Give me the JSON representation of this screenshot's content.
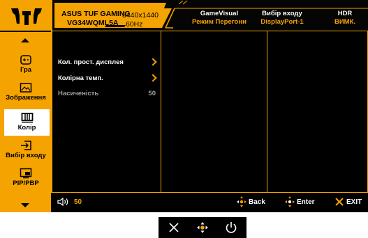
{
  "header": {
    "model_line1": "ASUS TUF GAMING",
    "model_line2": "VG34WQML5A",
    "resolution": "3440x1440",
    "refresh": "60Hz",
    "game_visual": {
      "title": "GameVisual",
      "value": "Режим Перегони"
    },
    "input": {
      "title": "Вибір входу",
      "value": "DisplayPort-1"
    },
    "hdr": {
      "title": "HDR",
      "value": "ВИМК."
    }
  },
  "sidebar": {
    "items": [
      {
        "label": "Гра",
        "icon": "gamepad-icon",
        "active": false
      },
      {
        "label": "Зображення",
        "icon": "image-icon",
        "active": false
      },
      {
        "label": "Колір",
        "icon": "color-icon",
        "active": true
      },
      {
        "label": "Вибір входу",
        "icon": "input-select-icon",
        "active": false
      },
      {
        "label": "PIP/PBP",
        "icon": "pip-pbp-icon",
        "active": false
      }
    ]
  },
  "menu": {
    "items": [
      {
        "label": "Кол. прост. дисплея",
        "type": "submenu"
      },
      {
        "label": "Колірна темп.",
        "type": "submenu"
      },
      {
        "label": "Насиченість",
        "value": "50",
        "type": "value",
        "disabled": true
      }
    ]
  },
  "footer": {
    "volume": "50",
    "back": "Back",
    "enter": "Enter",
    "exit": "EXIT"
  },
  "colors": {
    "accent": "#f5a300",
    "background": "#000000",
    "text": "#ffffff",
    "disabled": "#a0a0a0"
  },
  "hardware_keys": [
    "close-icon",
    "joystick-icon",
    "power-icon"
  ]
}
